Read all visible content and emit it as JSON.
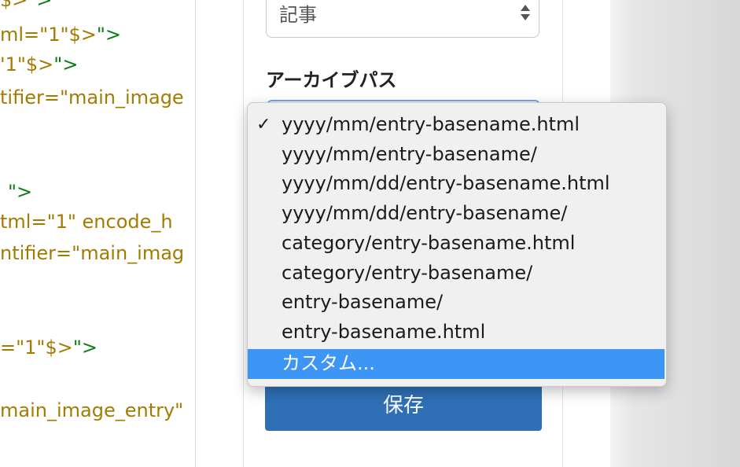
{
  "code_lines": [
    {
      "attr": "$>",
      "tag": "\">"
    },
    {
      "attr": "ml=\"1\"$>",
      "tag": "\">"
    },
    {
      "attr": "'1\"$>",
      "tag": "\">"
    },
    {
      "attr": "tifier=\"main_image",
      "tag": ""
    },
    {
      "attr": "",
      "tag": "\">"
    },
    {
      "attr": "tml=\"1\" encode_h",
      "tag": ""
    },
    {
      "attr": "ntifier=\"main_imag",
      "tag": ""
    },
    {
      "attr": "=\"1\"$>",
      "tag": "\">"
    },
    {
      "attr": "main_image_entry\"",
      "tag": ""
    }
  ],
  "panel": {
    "type_select_value": "記事",
    "archive_path_label": "アーカイブパス",
    "save_label": "保存"
  },
  "dropdown": {
    "selected_index": 0,
    "highlighted_index": 8,
    "checkmark": "✓",
    "options": [
      "yyyy/mm/entry-basename.html",
      "yyyy/mm/entry-basename/",
      "yyyy/mm/dd/entry-basename.html",
      "yyyy/mm/dd/entry-basename/",
      "category/entry-basename.html",
      "category/entry-basename/",
      "entry-basename/",
      "entry-basename.html",
      "カスタム..."
    ]
  },
  "colors": {
    "code_attr": "#a37b00",
    "code_tag": "#0a7d14",
    "highlight": "#3d95f5",
    "save_button": "#2f6fb6"
  }
}
